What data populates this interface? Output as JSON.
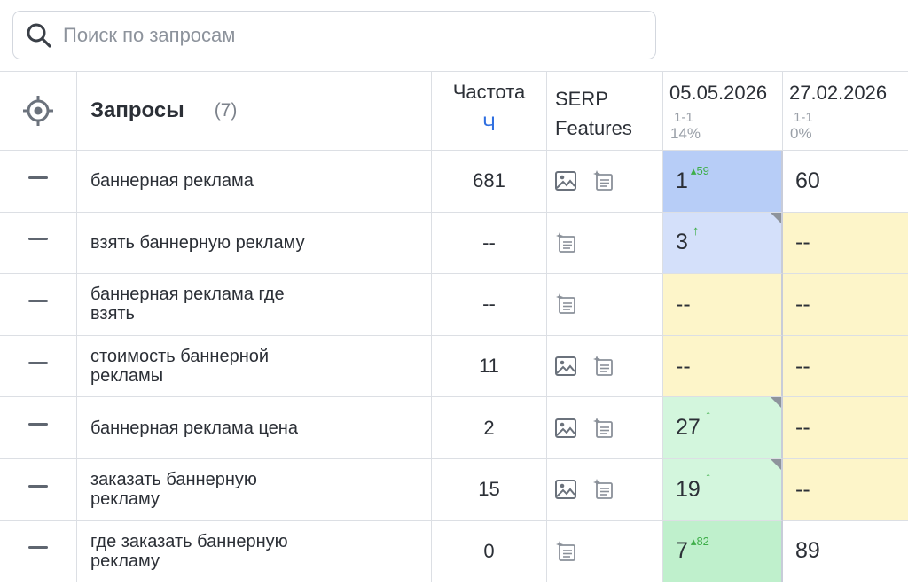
{
  "search": {
    "placeholder": "Поиск по запросам",
    "value": ""
  },
  "header": {
    "queries_title": "Запросы",
    "queries_count": "(7)",
    "frequency_title": "Частота",
    "frequency_unit": "Ч",
    "serp_line1": "SERP",
    "serp_line2": "Features",
    "dates": [
      {
        "date": "05.05.2026",
        "range": "1-1",
        "percent": "14%"
      },
      {
        "date": "27.02.2026",
        "range": "1-1",
        "percent": "0%"
      }
    ]
  },
  "rows": [
    {
      "query_l1": "баннерная реклама",
      "query_l2": "",
      "frequency": "681",
      "serp": [
        "image-icon",
        "snippet-icon"
      ],
      "pos1": {
        "value": "1",
        "delta": "59",
        "arrow": "",
        "color": "#b7cdf7",
        "flag": false
      },
      "pos2": {
        "value": "60",
        "color": "#ffffff"
      }
    },
    {
      "query_l1": "взять баннерную рекламу",
      "query_l2": "",
      "frequency": "--",
      "serp": [
        "snippet-icon"
      ],
      "pos1": {
        "value": "3",
        "delta": "",
        "arrow": "↑",
        "color": "#d4e0fa",
        "flag": true
      },
      "pos2": {
        "value": "--",
        "color": "#fdf5c9"
      }
    },
    {
      "query_l1": "баннерная реклама где",
      "query_l2": "взять",
      "frequency": "--",
      "serp": [
        "snippet-icon"
      ],
      "pos1": {
        "value": "--",
        "delta": "",
        "arrow": "",
        "color": "#fdf5c9",
        "flag": false
      },
      "pos2": {
        "value": "--",
        "color": "#fdf5c9"
      }
    },
    {
      "query_l1": "стоимость баннерной",
      "query_l2": "рекламы",
      "frequency": "11",
      "serp": [
        "image-icon",
        "snippet-icon"
      ],
      "pos1": {
        "value": "--",
        "delta": "",
        "arrow": "",
        "color": "#fdf5c9",
        "flag": false
      },
      "pos2": {
        "value": "--",
        "color": "#fdf5c9"
      }
    },
    {
      "query_l1": "баннерная реклама цена",
      "query_l2": "",
      "frequency": "2",
      "serp": [
        "image-icon",
        "snippet-icon"
      ],
      "pos1": {
        "value": "27",
        "delta": "",
        "arrow": "↑",
        "color": "#d3f6dd",
        "flag": true
      },
      "pos2": {
        "value": "--",
        "color": "#fdf5c9"
      }
    },
    {
      "query_l1": "заказать баннерную",
      "query_l2": "рекламу",
      "frequency": "15",
      "serp": [
        "image-icon",
        "snippet-icon"
      ],
      "pos1": {
        "value": "19",
        "delta": "",
        "arrow": "↑",
        "color": "#d3f6dd",
        "flag": true
      },
      "pos2": {
        "value": "--",
        "color": "#fdf5c9"
      }
    },
    {
      "query_l1": "где заказать баннерную",
      "query_l2": "рекламу",
      "frequency": "0",
      "serp": [
        "snippet-icon"
      ],
      "pos1": {
        "value": "7",
        "delta": "82",
        "arrow": "",
        "color": "#bff0cc",
        "flag": false
      },
      "pos2": {
        "value": "89",
        "color": "#ffffff"
      }
    }
  ]
}
